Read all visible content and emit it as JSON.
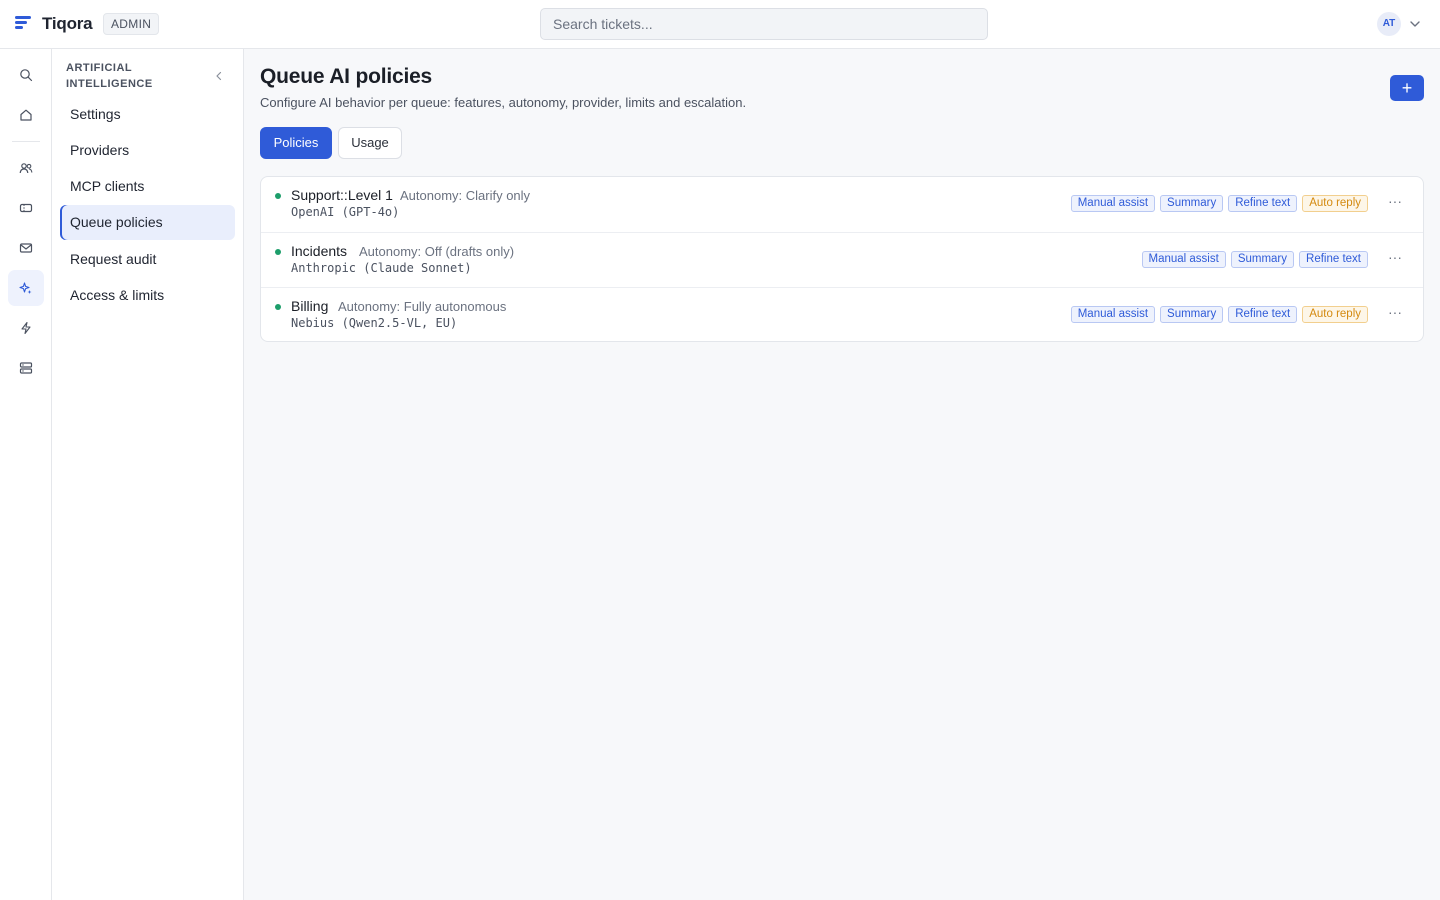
{
  "app": {
    "name": "Tiqora",
    "role_badge": "ADMIN"
  },
  "search": {
    "placeholder": "Search tickets..."
  },
  "user": {
    "initials": "AT"
  },
  "rail": {
    "icons": [
      "search-icon",
      "home-icon",
      "users-icon",
      "ticket-icon",
      "mail-icon",
      "sparkles-icon",
      "bolt-icon",
      "server-icon"
    ],
    "active": "sparkles-icon"
  },
  "sidebar": {
    "heading": "ARTIFICIAL INTELLIGENCE",
    "items": [
      {
        "label": "Settings"
      },
      {
        "label": "Providers"
      },
      {
        "label": "MCP clients"
      },
      {
        "label": "Queue policies",
        "active": true
      },
      {
        "label": "Request audit"
      },
      {
        "label": "Access & limits"
      }
    ]
  },
  "page": {
    "title": "Queue AI policies",
    "subtitle": "Configure AI behavior per queue: features, autonomy, provider, limits and escalation.",
    "add_label": "+",
    "tabs": [
      {
        "label": "Policies",
        "active": true
      },
      {
        "label": "Usage",
        "active": false
      }
    ]
  },
  "policies": [
    {
      "name": "Support::Level 1",
      "autonomy": "Autonomy: Clarify only",
      "provider": "OpenAI (GPT-4o)",
      "status_color": "#1d9e6b",
      "features": [
        "Manual assist",
        "Summary",
        "Refine text",
        "Auto reply"
      ]
    },
    {
      "name": "Incidents",
      "autonomy": "Autonomy: Off (drafts only)",
      "provider": "Anthropic (Claude Sonnet)",
      "status_color": "#1d9e6b",
      "features": [
        "Manual assist",
        "Summary",
        "Refine text"
      ]
    },
    {
      "name": "Billing",
      "autonomy": "Autonomy: Fully autonomous",
      "provider": "Nebius (Qwen2.5-VL, EU)",
      "status_color": "#1d9e6b",
      "features": [
        "Manual assist",
        "Summary",
        "Refine text",
        "Auto reply"
      ]
    }
  ],
  "row_menu_label": "···",
  "colors": {
    "accent": "#2f5bd8",
    "status_active": "#1d9e6b",
    "warning_tag": "#d48a10"
  }
}
